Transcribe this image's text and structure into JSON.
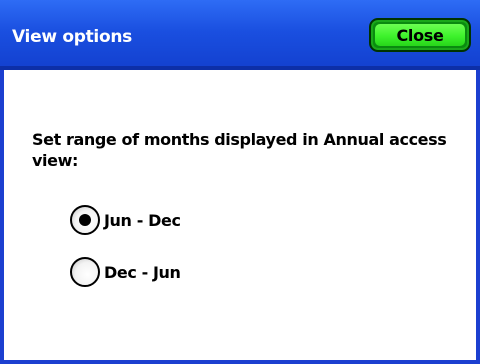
{
  "dialog": {
    "title": "View options",
    "close_label": "Close"
  },
  "settings": {
    "prompt": "Set range of months displayed in Annual access view:",
    "options": [
      {
        "label": "Jun - Dec",
        "selected": true
      },
      {
        "label": "Dec - Jun",
        "selected": false
      }
    ]
  },
  "colors": {
    "titlebar": "#1a4fe0",
    "close_button": "#3ef22c",
    "border": "#1c3fd0"
  }
}
